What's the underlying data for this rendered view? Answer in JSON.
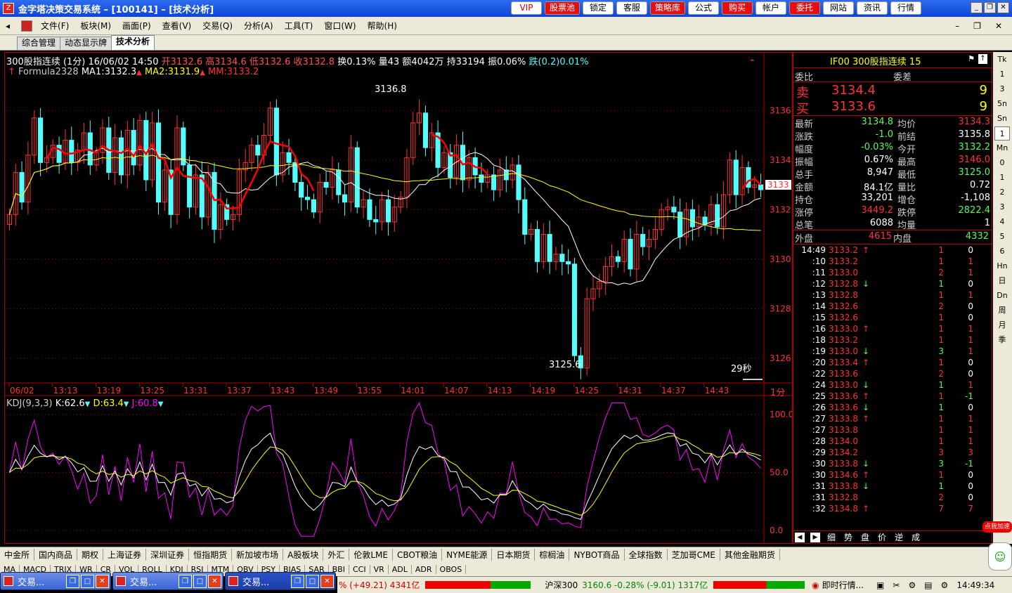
{
  "window": {
    "title": "金字塔决策交易系统  –  [100141]  –  [技术分析]"
  },
  "top_buttons": [
    {
      "label": "VIP",
      "style": "pink"
    },
    {
      "label": "股票池",
      "style": "red"
    },
    {
      "label": "锁定",
      "style": "normal"
    },
    {
      "label": "客服",
      "style": "normal"
    },
    {
      "label": "策略库",
      "style": "red"
    },
    {
      "label": "公式",
      "style": "normal"
    },
    {
      "label": "购买",
      "style": "red"
    },
    {
      "label": "帐户",
      "style": "normal"
    },
    {
      "label": "委托",
      "style": "red"
    },
    {
      "label": "网站",
      "style": "normal"
    },
    {
      "label": "资讯",
      "style": "normal"
    },
    {
      "label": "行情",
      "style": "normal"
    }
  ],
  "menu": [
    "文件(F)",
    "板块(M)",
    "画面(P)",
    "查看(V)",
    "交易(Q)",
    "分析(A)",
    "工具(T)",
    "窗口(W)",
    "帮助(H)"
  ],
  "tabs": [
    {
      "label": "综合管理",
      "active": false
    },
    {
      "label": "动态显示牌",
      "active": false
    },
    {
      "label": "技术分析",
      "active": true
    }
  ],
  "chart": {
    "header": {
      "name": "300股指连续 (1分) 16/06/02 14:50",
      "open": "开3132.6",
      "high": "高3134.6",
      "low": "低3132.6",
      "close": "收3132.8",
      "turnover": "换0.13%",
      "volume": "量43",
      "amount": "额4042万",
      "hold": "持33194",
      "amplitude": "振0.06%",
      "change": "跌(0.2)0.01%"
    },
    "formula": {
      "name": "Formula2328",
      "ma1": "MA1:3132.3",
      "ma2": "MA2:3131.9",
      "mm": "MM:3133.2"
    },
    "kdj": {
      "name": "KDJ(9,3,3)",
      "k": "K:62.6",
      "d": "D:63.4",
      "j": "J:60.8"
    },
    "high_label": "3136.8",
    "low_label": "3125.6",
    "countdown": "29秒",
    "price_marker": "3133",
    "period_label": "1分",
    "y_ticks": [
      "3136",
      "3134",
      "3132",
      "3130",
      "3128",
      "3126"
    ],
    "kdj_ticks": [
      "100.0",
      "50.0",
      "0.0"
    ],
    "x_ticks": [
      "06/02",
      "13:13",
      "13:19",
      "13:25",
      "13:31",
      "13:37",
      "13:43",
      "13:49",
      "13:55",
      "14:01",
      "14:07",
      "14:13",
      "14:19",
      "14:25",
      "14:31",
      "14:37",
      "14:43"
    ],
    "colors": {
      "up": "#ff3232",
      "down": "#54fcfc",
      "ma_white": "#ffffff",
      "ma_yellow": "#ffff00",
      "mm_red": "#ff0000",
      "j_line": "#ff00ff",
      "grid": "#b00000"
    }
  },
  "chart_data": {
    "type": "candlestick",
    "title": "300股指连续 (1分) 16/06/02",
    "ylim": [
      3125,
      3137.2
    ],
    "close": [
      3131.8,
      3133.5,
      3132.3,
      3134.2,
      3135.7,
      3133.9,
      3134.1,
      3134.6,
      3133.9,
      3134.8,
      3133.9,
      3134.4,
      3135.1,
      3133.8,
      3134.3,
      3135.3,
      3133.5,
      3134.9,
      3133.4,
      3135.2,
      3133.8,
      3135.6,
      3133.2,
      3135.5,
      3132.3,
      3133.6,
      3131.8,
      3135.3,
      3133.8,
      3132.1,
      3133.4,
      3131.7,
      3133.5,
      3131.2,
      3132.2,
      3131.6,
      3131.8,
      3133.6,
      3133.9,
      3134.6,
      3134.2,
      3135.0,
      3136.1,
      3133.4,
      3134.3,
      3133.9,
      3133.1,
      3132.5,
      3132.4,
      3131.9,
      3133.1,
      3132.9,
      3133.6,
      3132.6,
      3132.3,
      3134.5,
      3132.1,
      3132.4,
      3131.6,
      3131.5,
      3132.4,
      3131.5,
      3132.1,
      3132.5,
      3134.1,
      3135.5,
      3135.9,
      3134.5,
      3135.1,
      3133.7,
      3134.3,
      3133.3,
      3134.6,
      3133.2,
      3134.1,
      3133.4,
      3133.1,
      3133.4,
      3132.8,
      3133.6,
      3133.2,
      3133.8,
      3132.4,
      3131.0,
      3131.2,
      3129.9,
      3131.0,
      3129.9,
      3130.2,
      3129.9,
      3129.8,
      3126.1,
      3125.6,
      3128.4,
      3128.8,
      3129.1,
      3129.7,
      3130.1,
      3129.9,
      3130.8,
      3129.6,
      3131.0,
      3130.5,
      3130.8,
      3131.2,
      3132.0,
      3132.1,
      3131.9,
      3130.9,
      3132.0,
      3131.3,
      3131.7,
      3131.4,
      3132.2,
      3131.3,
      3132.6,
      3134.0,
      3132.6,
      3133.7,
      3132.9,
      3133.0,
      3132.8
    ]
  },
  "quote": {
    "title": "IF00 300股指连续 15",
    "header": [
      "委比",
      "委差"
    ],
    "sell": {
      "label": "卖",
      "price": "3134.4",
      "vol": "9"
    },
    "buy": {
      "label": "买",
      "price": "3133.6",
      "vol": "9"
    },
    "rows": [
      [
        "最新",
        "3134.8",
        "均价",
        "3134.3"
      ],
      [
        "涨跌",
        "-1.0",
        "前结",
        "3135.8"
      ],
      [
        "幅度",
        "-0.03%",
        "今开",
        "3132.2"
      ],
      [
        "振幅",
        "0.67%",
        "最高",
        "3146.0"
      ],
      [
        "总手",
        "8,947",
        "最低",
        "3125.0"
      ],
      [
        "金额",
        "84.1亿",
        "量比",
        "0.72"
      ],
      [
        "持仓",
        "33,201",
        "增仓",
        "-1,108"
      ],
      [
        "涨停",
        "3449.2",
        "跌停",
        "2822.4"
      ],
      [
        "总笔",
        "6088",
        "均量",
        "1"
      ]
    ],
    "outer": {
      "label": "外盘",
      "value": "4615"
    },
    "inner": {
      "label": "内盘",
      "value": "4332"
    },
    "ticks": [
      [
        "14:49",
        "3133.2",
        "↑",
        "1",
        "0"
      ],
      [
        ":10",
        "3133.2",
        "",
        "1",
        "1"
      ],
      [
        ":11",
        "3133.0",
        "",
        "2",
        "1"
      ],
      [
        ":12",
        "3132.8",
        "↓",
        "1",
        "0"
      ],
      [
        ":13",
        "3132.8",
        "",
        "1",
        "1"
      ],
      [
        ":14",
        "3132.6",
        "",
        "2",
        "0"
      ],
      [
        ":15",
        "3132.6",
        "",
        "1",
        "0"
      ],
      [
        ":16",
        "3133.0",
        "↑",
        "1",
        "1"
      ],
      [
        ":18",
        "3133.2",
        "",
        "1",
        "1"
      ],
      [
        ":19",
        "3133.0",
        "↓",
        "3",
        "1"
      ],
      [
        ":20",
        "3133.4",
        "↑",
        "1",
        "0"
      ],
      [
        ":22",
        "3133.6",
        "",
        "2",
        "0"
      ],
      [
        ":24",
        "3133.0",
        "↓",
        "1",
        "1"
      ],
      [
        ":25",
        "3133.6",
        "↑",
        "1",
        "-1"
      ],
      [
        ":26",
        "3133.6",
        "↓",
        "1",
        "0"
      ],
      [
        ":27",
        "3133.8",
        "↑",
        "1",
        "1"
      ],
      [
        ":27",
        "3133.8",
        "",
        "1",
        "1"
      ],
      [
        ":28",
        "3134.0",
        "",
        "1",
        "1"
      ],
      [
        ":29",
        "3134.2",
        "",
        "3",
        "3"
      ],
      [
        ":30",
        "3133.8",
        "↓",
        "3",
        "-1"
      ],
      [
        ":30",
        "3134.6",
        "↑",
        "1",
        "0"
      ],
      [
        ":31",
        "3133.8",
        "↓",
        "1",
        "0"
      ],
      [
        ":31",
        "3132.8",
        "",
        "2",
        "0"
      ],
      [
        ":32",
        "3134.8",
        "↑",
        "7",
        "7"
      ]
    ],
    "bottom_tabs": [
      "细",
      "势",
      "盘",
      "价",
      "逆",
      "成"
    ]
  },
  "period_buttons": [
    "Tk",
    "1",
    "3",
    "5n",
    "Sn",
    "1",
    "Mn",
    "0",
    "1",
    "2",
    "3",
    "4",
    "5",
    "6",
    "Hn",
    "日",
    "Dn",
    "周",
    "月",
    "季"
  ],
  "market_tabs": [
    "中金所",
    "国内商品",
    "期权",
    "上海证券",
    "深圳证券",
    "恒指期货",
    "新加坡市场",
    "A股板块",
    "外汇",
    "伦敦LME",
    "CBOT粮油",
    "NYME能源",
    "日本期货",
    "棕榈油",
    "NYBOT商品",
    "全球指数",
    "芝加哥CME",
    "其他金融期货"
  ],
  "indicator_tabs": [
    "MA",
    "MACD",
    "TRIX",
    "WR",
    "CR",
    "VOL",
    "ROLL",
    "KDJ",
    "RSI",
    "MTM",
    "OBV",
    "PSY",
    "BIAS",
    "SAR",
    "BBI",
    "CCI",
    "VR",
    "ADL",
    "ADR",
    "OBOS"
  ],
  "taskbar": [
    {
      "label": "交易...",
      "active": false
    },
    {
      "label": "交易...",
      "active": false
    },
    {
      "label": "交易...",
      "active": true
    }
  ],
  "status": {
    "left_fragment": "% (+49.21) 4341亿",
    "index_name": "沪深300",
    "index_value": "3160.6 -0.28% (-9.01) 1317亿",
    "news": "即时行情...",
    "time": "14:49:34",
    "promo": "点我加速"
  }
}
